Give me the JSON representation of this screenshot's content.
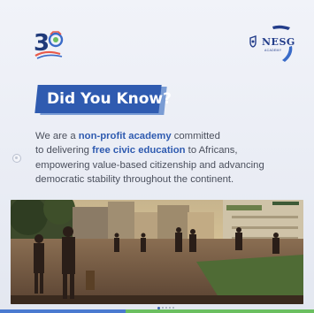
{
  "logo_30": {
    "number": "3"
  },
  "nesg": {
    "name": "NESG",
    "sub": "ACADEMY"
  },
  "heading": "Did You Know?",
  "body": {
    "line1_a": "We are a ",
    "line1_b": "non-profit academy",
    "line1_c": " committed",
    "line2_a": "to delivering ",
    "line2_b": "free civic education",
    "line2_c": " to Africans,",
    "line3": "empowering value-based citizenship and advancing",
    "line4": "democratic stability throughout the continent."
  },
  "colors": {
    "brand_blue": "#2f5bb0",
    "accent_light_blue": "#7a9cd4",
    "text_gray": "#4a4f5c",
    "brand_green": "#6bbf60"
  },
  "icons": [
    "shield-icon",
    "prev-arrow-icon"
  ],
  "carousel": {
    "slides": 5,
    "active_index": 1
  }
}
